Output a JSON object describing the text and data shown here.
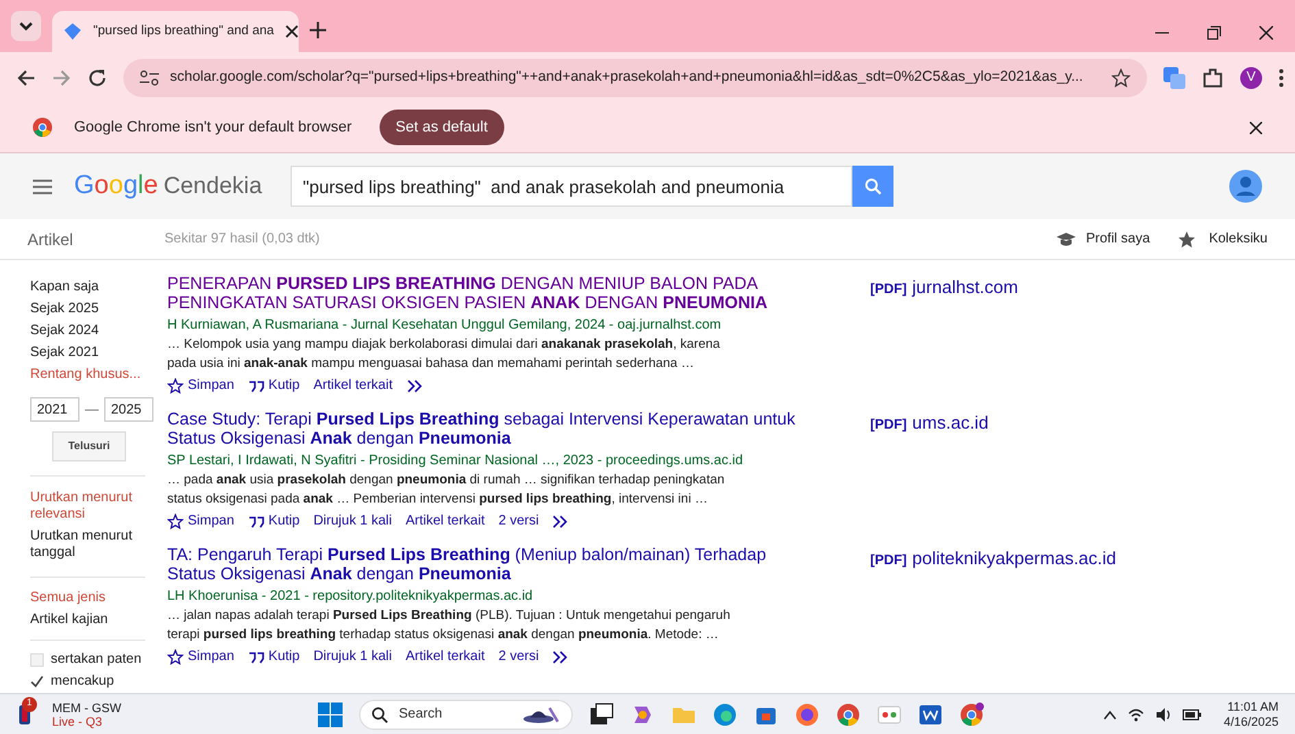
{
  "browser": {
    "tab": {
      "title": "\"pursed lips breathing\" and ana"
    },
    "url": "scholar.google.com/scholar?q=\"pursed+lips+breathing\"++and+anak+prasekolah+and+pneumonia&hl=id&as_sdt=0%2C5&as_ylo=2021&as_y...",
    "profile_initial": "V"
  },
  "infobar": {
    "message": "Google Chrome isn't your default browser",
    "button": "Set as default"
  },
  "header": {
    "logo_google": "Google",
    "logo_product": "Cendekia",
    "query": "\"pursed lips breathing\"  and anak prasekolah and pneumonia"
  },
  "subheader": {
    "section": "Artikel",
    "stats": "Sekitar 97 hasil (0,03 dtk)",
    "links": [
      "Profil saya",
      "Koleksiku"
    ]
  },
  "sidebar": {
    "time_filters": [
      {
        "label": "Kapan saja",
        "selected": false
      },
      {
        "label": "Sejak 2025",
        "selected": false
      },
      {
        "label": "Sejak 2024",
        "selected": false
      },
      {
        "label": "Sejak 2021",
        "selected": false
      },
      {
        "label": "Rentang khusus...",
        "selected": true
      }
    ],
    "year_from": "2021",
    "dash": "—",
    "year_to": "2025",
    "search_button": "Telusuri",
    "sort": [
      {
        "label": "Urutkan menurut relevansi",
        "selected": true
      },
      {
        "label": "Urutkan menurut tanggal",
        "selected": false
      }
    ],
    "types": [
      {
        "label": "Semua jenis",
        "selected": true
      },
      {
        "label": "Artikel kajian",
        "selected": false
      }
    ],
    "options": [
      {
        "label": "sertakan paten",
        "checked": false
      },
      {
        "label": "mencakup",
        "checked": true
      }
    ]
  },
  "results": [
    {
      "title": "PENERAPAN **PURSED LIPS BREATHING** DENGAN MENIUP BALON PADA PENINGKATAN SATURASI OKSIGEN PASIEN **ANAK** DENGAN **PNEUMONIA**",
      "visited": true,
      "meta": "H Kurniawan, A Rusmariana - Jurnal Kesehatan Unggul Gemilang, 2024 - oaj.jurnalhst.com",
      "snippet": "… Kelompok usia yang mampu diajak berkolaborasi dimulai dari **anakanak prasekolah**, karena pada usia ini **anak-anak** mampu menguasai bahasa dan memahami perintah sederhana …",
      "actions": [
        "Simpan",
        "Kutip",
        "Artikel terkait"
      ],
      "pdf_tag": "[PDF]",
      "pdf_source": "jurnalhst.com"
    },
    {
      "title": "Case Study: Terapi **Pursed Lips Breathing** sebagai Intervensi Keperawatan untuk Status Oksigenasi **Anak** dengan **Pneumonia**",
      "visited": false,
      "meta": "SP Lestari, I Irdawati, N Syafitri - Prosiding Seminar Nasional …, 2023 - proceedings.ums.ac.id",
      "snippet": "… pada **anak** usia **prasekolah** dengan **pneumonia** di rumah … signifikan terhadap peningkatan status oksigenasi pada **anak** … Pemberian intervensi **pursed lips breathing**, intervensi ini …",
      "actions": [
        "Simpan",
        "Kutip",
        "Dirujuk 1 kali",
        "Artikel terkait",
        "2 versi"
      ],
      "pdf_tag": "[PDF]",
      "pdf_source": "ums.ac.id"
    },
    {
      "title": "TA: Pengaruh Terapi **Pursed Lips Breathing** (Meniup balon/mainan) Terhadap Status Oksigenasi **Anak** dengan **Pneumonia**",
      "visited": false,
      "meta": "LH Khoerunisa - 2021 - repository.politeknikyakpermas.ac.id",
      "snippet": "… jalan napas adalah terapi **Pursed Lips Breathing** (PLB). Tujuan : Untuk mengetahui pengaruh terapi **pursed lips breathing** terhadap status oksigenasi **anak** dengan **pneumonia**. Metode: …",
      "actions": [
        "Simpan",
        "Kutip",
        "Dirujuk 1 kali",
        "Artikel terkait",
        "2 versi"
      ],
      "pdf_tag": "[PDF]",
      "pdf_source": "politeknikyakpermas.ac.id"
    }
  ],
  "taskbar": {
    "widget_badge": "1",
    "widget_title": "MEM - GSW",
    "widget_status": "Live - Q3",
    "search": "Search",
    "time": "11:01 AM",
    "date": "4/16/2025"
  }
}
